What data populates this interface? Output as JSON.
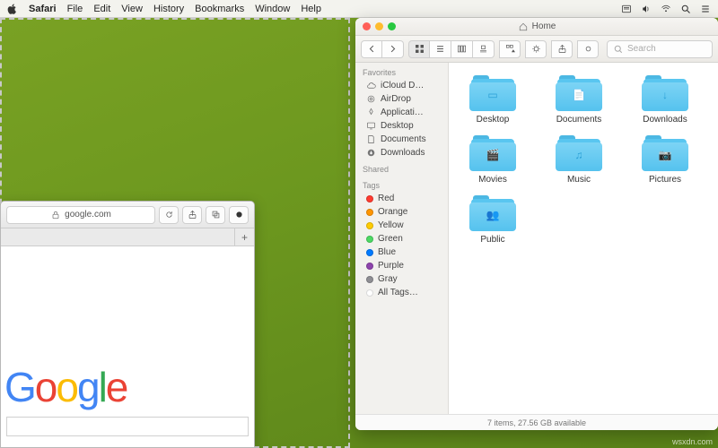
{
  "menubar": {
    "app": "Safari",
    "items": [
      "File",
      "Edit",
      "View",
      "History",
      "Bookmarks",
      "Window",
      "Help"
    ]
  },
  "safari": {
    "url": "google.com",
    "logo_letters": [
      "G",
      "o",
      "o",
      "g",
      "l",
      "e"
    ]
  },
  "finder": {
    "title": "Home",
    "search_placeholder": "Search",
    "sidebar": {
      "favorites_hdr": "Favorites",
      "favorites": [
        {
          "label": "iCloud D…",
          "icon": "cloud"
        },
        {
          "label": "AirDrop",
          "icon": "airdrop"
        },
        {
          "label": "Applicati…",
          "icon": "apps"
        },
        {
          "label": "Desktop",
          "icon": "desktop"
        },
        {
          "label": "Documents",
          "icon": "documents"
        },
        {
          "label": "Downloads",
          "icon": "downloads"
        }
      ],
      "shared_hdr": "Shared",
      "tags_hdr": "Tags",
      "tags": [
        {
          "label": "Red",
          "color": "#ff3b30"
        },
        {
          "label": "Orange",
          "color": "#ff9500"
        },
        {
          "label": "Yellow",
          "color": "#ffcc00"
        },
        {
          "label": "Green",
          "color": "#4cd964"
        },
        {
          "label": "Blue",
          "color": "#007aff"
        },
        {
          "label": "Purple",
          "color": "#8e44ad"
        },
        {
          "label": "Gray",
          "color": "#8e8e93"
        }
      ],
      "all_tags_label": "All Tags…"
    },
    "folders": [
      {
        "label": "Desktop",
        "glyph": "▭"
      },
      {
        "label": "Documents",
        "glyph": "📄"
      },
      {
        "label": "Downloads",
        "glyph": "↓"
      },
      {
        "label": "Movies",
        "glyph": "🎬"
      },
      {
        "label": "Music",
        "glyph": "♫"
      },
      {
        "label": "Pictures",
        "glyph": "📷"
      },
      {
        "label": "Public",
        "glyph": "👥"
      }
    ],
    "statusbar": "7 items, 27.56 GB available"
  },
  "watermark": "wsxdn.com"
}
